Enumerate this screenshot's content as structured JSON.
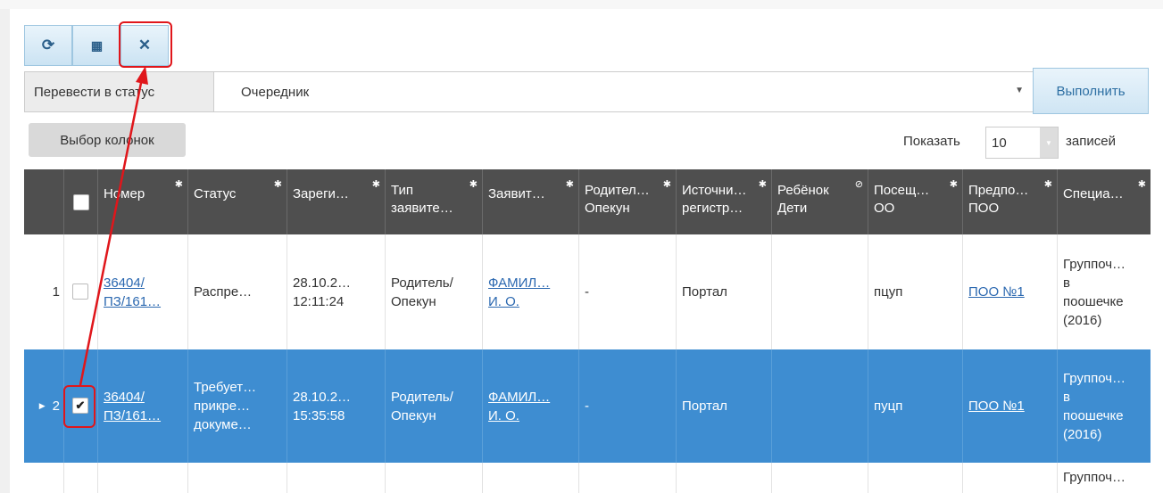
{
  "toolbar": {
    "refresh_icon": "refresh-icon",
    "columns_icon": "grid-icon",
    "clear_icon": "close-icon"
  },
  "status_bar": {
    "label": "Перевести в статус",
    "selected": "Очередник",
    "execute_label": "Выполнить"
  },
  "columns_button": "Выбор колонок",
  "pagination": {
    "show_label": "Показать",
    "page_size": "10",
    "entries_label": "записей"
  },
  "table": {
    "headers": [
      "Номер",
      "Статус",
      "Зареги…",
      "Тип\nзаявите…",
      "Заявит…",
      "Родител…\nОпекун",
      "Источни…\nрегистр…",
      "Ребёнок\nДети",
      "Посещ…\nОО",
      "Предпо…\nПОО",
      "Специа…"
    ],
    "rows": [
      {
        "index": "1",
        "checked": false,
        "number": "36404/\nПЗ/161…",
        "status": "Распре…",
        "registered": "28.10.2…\n12:11:24",
        "applicant_type": "Родитель/\nОпекун",
        "applicant": "ФАМИЛ…\nИ. О.",
        "parent": "-",
        "source": "Портал",
        "child": "",
        "visited": "пцуп",
        "preferred": "ПОО №1",
        "specialty": "Группоч…\nв\nпоошечке\n(2016)"
      },
      {
        "index": "2",
        "checked": true,
        "number": "36404/\nПЗ/161…",
        "status": "Требует…\nприкре…\nдокуме…",
        "registered": "28.10.2…\n15:35:58",
        "applicant_type": "Родитель/\nОпекун",
        "applicant": "ФАМИЛ…\nИ. О.",
        "parent": "-",
        "source": "Портал",
        "child": "",
        "visited": "пуцп",
        "preferred": "ПОО №1",
        "specialty": "Группоч…\nв\nпоошечке\n(2016)"
      },
      {
        "specialty": "Группоч…"
      }
    ]
  },
  "colors": {
    "header_bg": "#4f4f4f",
    "selected_row": "#3e8dd1",
    "highlight": "#e0161b"
  }
}
